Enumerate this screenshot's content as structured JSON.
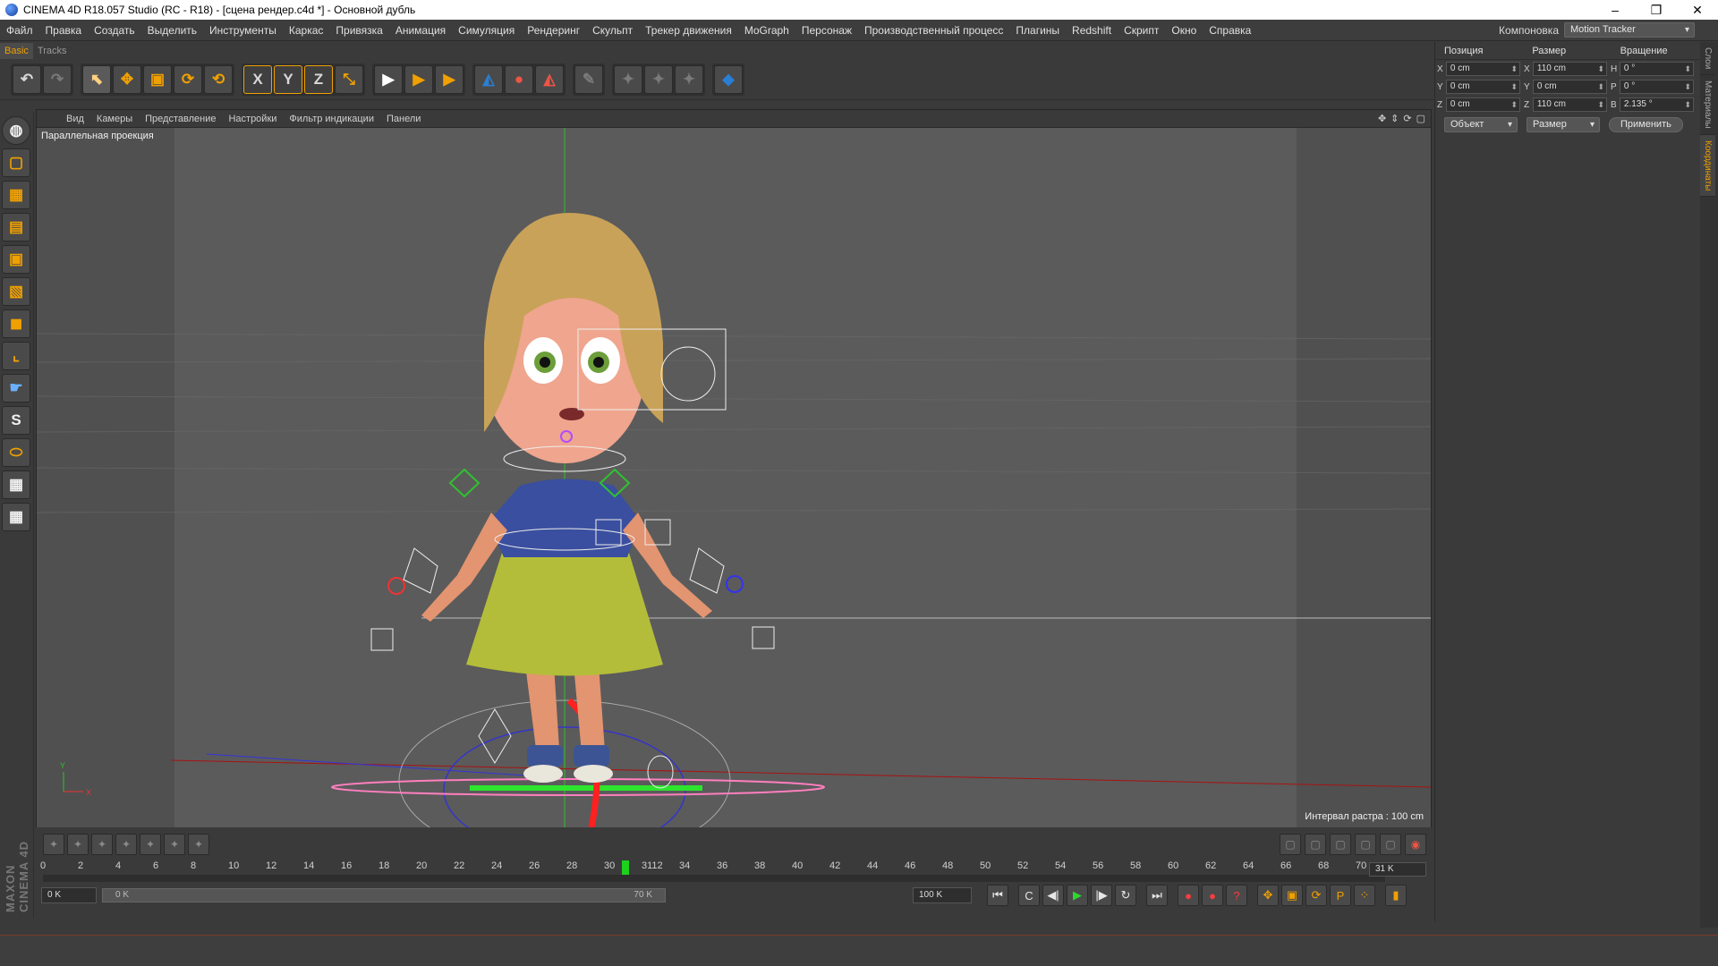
{
  "window": {
    "title": "CINEMA 4D R18.057 Studio (RC - R18) - [сцена рендер.c4d *] - Основной дубль",
    "controls": [
      "–",
      "❐",
      "✕"
    ]
  },
  "menu": [
    "Файл",
    "Правка",
    "Создать",
    "Выделить",
    "Инструменты",
    "Каркас",
    "Привязка",
    "Анимация",
    "Симуляция",
    "Рендеринг",
    "Скульпт",
    "Трекер движения",
    "MoGraph",
    "Персонаж",
    "Производственный процесс",
    "Плагины",
    "Redshift",
    "Скрипт",
    "Окно",
    "Справка"
  ],
  "layout": {
    "label": "Компоновка",
    "value": "Motion Tracker"
  },
  "tabs": [
    "Basic",
    "Tracks"
  ],
  "toolbar": {
    "undo": "↶",
    "redo": "↷",
    "groups": [
      [
        "⬉",
        "✥",
        "▣",
        "⟳",
        "⟲"
      ],
      [
        "X",
        "Y",
        "Z",
        "⤡"
      ],
      [
        "▶",
        "▶",
        "▶"
      ],
      [
        "◭",
        "●",
        "◭"
      ],
      [
        "✎"
      ],
      [
        "✦",
        "✦",
        "✦"
      ],
      [
        "◆"
      ]
    ]
  },
  "left_tools": [
    "◍",
    "▢",
    "▦",
    "▤",
    "▣",
    "▧",
    "◼",
    "⌞",
    "☛",
    "S",
    "⬭",
    "▦",
    "▦"
  ],
  "viewport": {
    "menu": [
      "Вид",
      "Камеры",
      "Представление",
      "Настройки",
      "Фильтр индикации",
      "Панели"
    ],
    "nav_icons": [
      "✥",
      "⇕",
      "⟳",
      "▢"
    ],
    "projection_label": "Параллельная проекция",
    "grid_label": "Интервал растра : 100 cm",
    "axis_labels": {
      "y": "Y",
      "x": "X"
    }
  },
  "timeline": {
    "ticks": [
      "0",
      "2",
      "4",
      "6",
      "8",
      "10",
      "12",
      "14",
      "16",
      "18",
      "20",
      "22",
      "24",
      "26",
      "28",
      "30",
      "3112",
      "34",
      "36",
      "38",
      "40",
      "42",
      "44",
      "46",
      "48",
      "50",
      "52",
      "54",
      "56",
      "58",
      "60",
      "62",
      "64",
      "66",
      "68",
      "70"
    ],
    "current_frame": 31,
    "frame_field": "31 K",
    "start": "0 K",
    "range_start": "0 K",
    "range_end": "70 K",
    "end": "100 K",
    "transport": [
      "⏮",
      "C",
      "◀|",
      "▶",
      "|▶",
      "↻",
      "⏭"
    ],
    "keys": [
      "●",
      "●",
      "?"
    ],
    "modes": [
      "✥",
      "▣",
      "⟳",
      "P",
      "⁘",
      "▮"
    ]
  },
  "coordinates": {
    "headers": [
      "Позиция",
      "Размер",
      "Вращение"
    ],
    "rows": [
      {
        "axis": "X",
        "pos": "0 cm",
        "size_axis": "X",
        "size": "110 cm",
        "rot_axis": "H",
        "rot": "0 °"
      },
      {
        "axis": "Y",
        "pos": "0 cm",
        "size_axis": "Y",
        "size": "0 cm",
        "rot_axis": "P",
        "rot": "0 °"
      },
      {
        "axis": "Z",
        "pos": "0 cm",
        "size_axis": "Z",
        "size": "110 cm",
        "rot_axis": "B",
        "rot": "2.135 °"
      }
    ],
    "mode": "Объект",
    "size_mode": "Размер",
    "apply": "Применить"
  },
  "side_tabs": [
    "Слои",
    "Материалы",
    "Координаты"
  ],
  "brand": "MAXON CINEMA 4D",
  "colors": {
    "accent": "#f0a000",
    "playhead": "#1dd11d"
  }
}
